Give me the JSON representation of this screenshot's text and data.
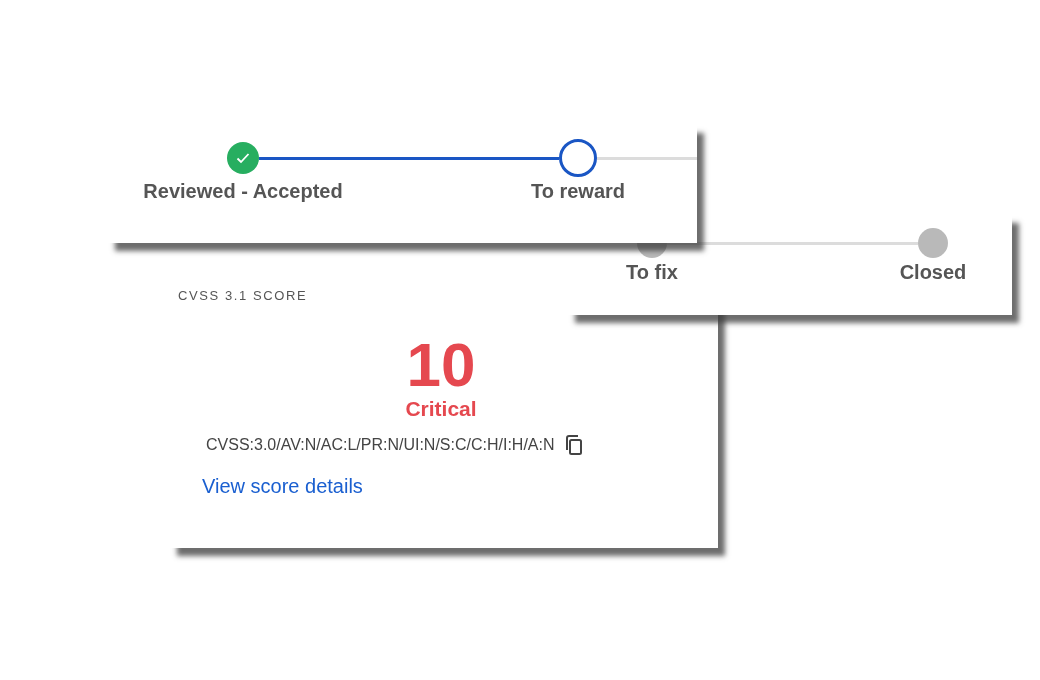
{
  "progress_cards": [
    {
      "continues": true,
      "steps": [
        {
          "label": "Reviewed - Accepted",
          "completed": true,
          "selected": false
        },
        {
          "label": "To reward",
          "completed": false,
          "selected": true
        }
      ]
    },
    {
      "continues": false,
      "steps": [
        {
          "label": "To fix",
          "completed": false,
          "selected": false
        },
        {
          "label": "Closed",
          "completed": false,
          "selected": false
        }
      ]
    }
  ],
  "score_card": {
    "heading": "CVSS 3.1 SCORE",
    "score": "10",
    "severity": "Critical",
    "vector": "CVSS:3.0/AV:N/AC:L/PR:N/UI:N/S:C/C:H/I:H/A:N",
    "link": "View score details"
  }
}
